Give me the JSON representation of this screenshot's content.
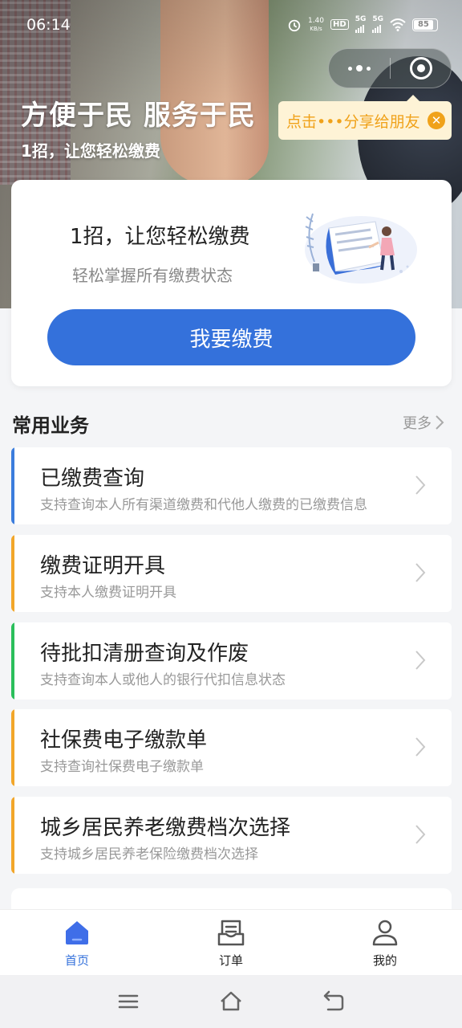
{
  "status_bar": {
    "time": "06:14",
    "net_speed_value": "1.40",
    "net_speed_unit": "KB/s",
    "hd_label": "HD",
    "sim1": "5G",
    "sim2": "5G",
    "battery": "85",
    "icons": [
      "alarm-icon",
      "hd-icon",
      "signal-icon",
      "signal-icon",
      "wifi-icon",
      "battery-icon"
    ]
  },
  "hero": {
    "title": "方便于民 服务于民",
    "subtitle": "1招，让您轻松缴费"
  },
  "share_tip": {
    "text": "点击•••分享给朋友",
    "close_icon": "close-icon"
  },
  "pay_card": {
    "title": "1招，让您轻松缴费",
    "desc": "轻松掌握所有缴费状态",
    "button": "我要缴费"
  },
  "services": {
    "section_title": "常用业务",
    "more": "更多",
    "items": [
      {
        "name": "已缴费查询",
        "note": "支持查询本人所有渠道缴费和代他人缴费的已缴费信息",
        "color": "#3b7ddd"
      },
      {
        "name": "缴费证明开具",
        "note": "支持本人缴费证明开具",
        "color": "#f2a62a"
      },
      {
        "name": "待批扣清册查询及作废",
        "note": "支持查询本人或他人的银行代扣信息状态",
        "color": "#2bbf5b"
      },
      {
        "name": "社保费电子缴款单",
        "note": "支持查询社保费电子缴款单",
        "color": "#f2a62a"
      },
      {
        "name": "城乡居民养老缴费档次选择",
        "note": "支持城乡居民养老保险缴费档次选择",
        "color": "#f2a62a"
      }
    ]
  },
  "tabbar": {
    "items": [
      {
        "label": "首页",
        "icon": "home-icon",
        "active": true
      },
      {
        "label": "订单",
        "icon": "order-icon",
        "active": false
      },
      {
        "label": "我的",
        "icon": "user-icon",
        "active": false
      }
    ]
  },
  "colors": {
    "primary": "#3471db",
    "tip_text": "#f0a21a",
    "tip_bg": "#fef3d6"
  }
}
